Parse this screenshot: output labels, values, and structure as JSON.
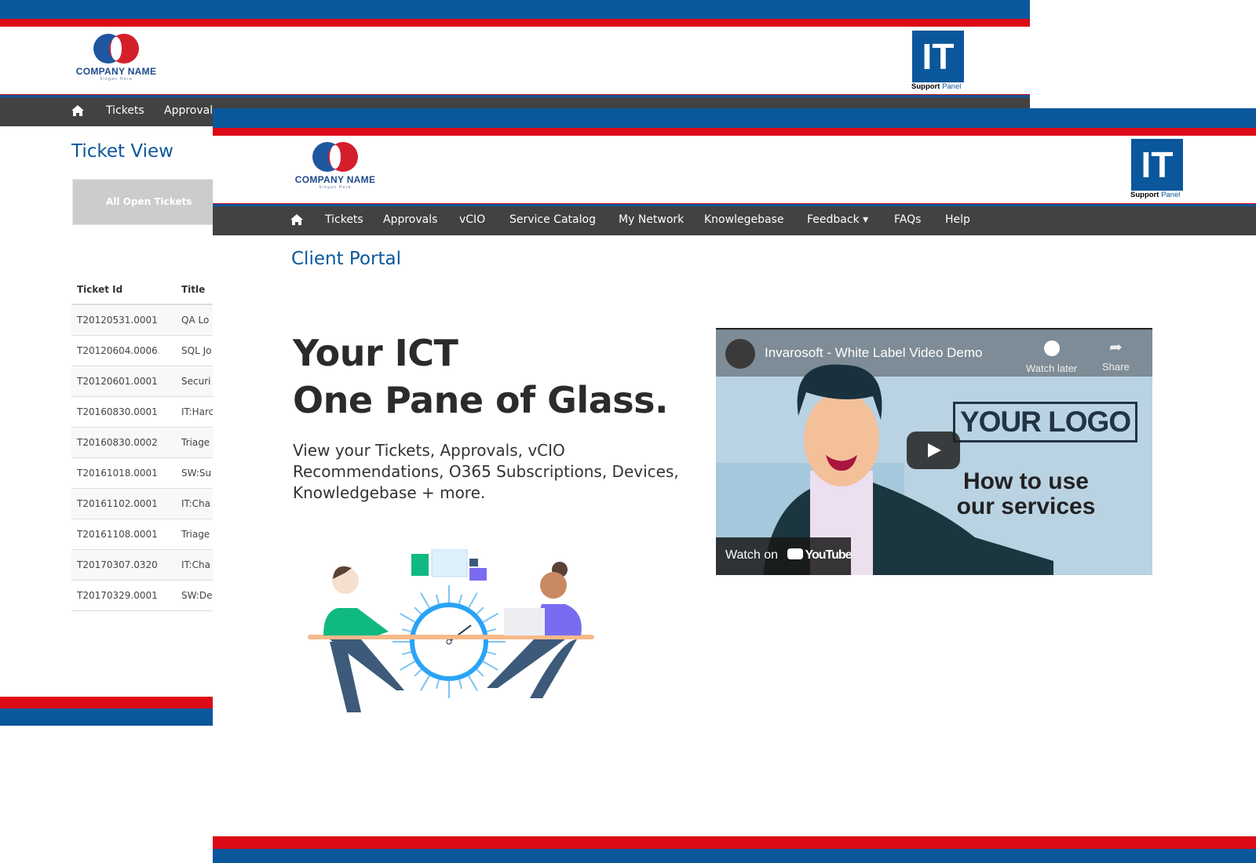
{
  "back_window": {
    "company": {
      "name": "COMPANY NAME",
      "slogan": "Slogan Here"
    },
    "it_logo": {
      "letters": "IT",
      "caption_a": "Support",
      "caption_b": "Panel"
    },
    "nav": [
      "Tickets",
      "Approval"
    ],
    "page_title": "Ticket View",
    "filter_button": "All Open Tickets",
    "table": {
      "headers": [
        "Ticket Id",
        "Title"
      ],
      "rows": [
        [
          "T20120531.0001",
          "QA Lo"
        ],
        [
          "T20120604.0006",
          "SQL Jo"
        ],
        [
          "T20120601.0001",
          "Securi"
        ],
        [
          "T20160830.0001",
          "IT:Harc"
        ],
        [
          "T20160830.0002",
          "Triage"
        ],
        [
          "T20161018.0001",
          "SW:Su"
        ],
        [
          "T20161102.0001",
          "IT:Cha"
        ],
        [
          "T20161108.0001",
          "Triage"
        ],
        [
          "T20170307.0320",
          "IT:Cha"
        ],
        [
          "T20170329.0001",
          "SW:De"
        ]
      ]
    }
  },
  "front_window": {
    "company": {
      "name": "COMPANY NAME",
      "slogan": "Slogan Here"
    },
    "it_logo": {
      "letters": "IT",
      "caption_a": "Support",
      "caption_b": "Panel"
    },
    "nav": [
      "Tickets",
      "Approvals",
      "vCIO",
      "Service Catalog",
      "My Network",
      "Knowlegebase",
      "Feedback ▾",
      "FAQs",
      "Help"
    ],
    "page_title": "Client Portal",
    "hero": {
      "line1": "Your ICT",
      "line2": "One Pane of Glass."
    },
    "description": "View your Tickets, Approvals, vCIO Recommendations, O365 Subscriptions, Devices, Knowledgebase + more.",
    "video": {
      "title": "Invarosoft - White Label Video Demo",
      "watch_later": "Watch later",
      "share": "Share",
      "logo_text": "YOUR LOGO",
      "caption": "How to use our services",
      "watch_on": "Watch on",
      "youtube": "YouTube"
    }
  },
  "colors": {
    "brand_blue": "#0b579c",
    "brand_red": "#dc0a17",
    "nav_bg": "#424242"
  }
}
